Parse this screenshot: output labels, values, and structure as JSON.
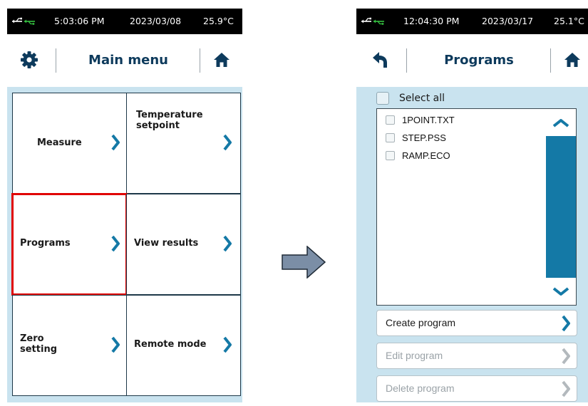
{
  "left_screen": {
    "status": {
      "time": "5:03:06 PM",
      "date": "2023/03/08",
      "temperature": "25.9°C"
    },
    "title": "Main menu",
    "tiles": [
      {
        "label": "Measure",
        "selected": false
      },
      {
        "label": "Temperature setpoint",
        "selected": false
      },
      {
        "label": "Programs",
        "selected": true
      },
      {
        "label": "View results",
        "selected": false
      },
      {
        "label": "Zero setting",
        "selected": false
      },
      {
        "label": "Remote mode",
        "selected": false
      }
    ],
    "icons": {
      "left": "gear-icon",
      "right": "home-icon"
    }
  },
  "right_screen": {
    "status": {
      "time": "12:04:30 PM",
      "date": "2023/03/17",
      "temperature": "25.1°C"
    },
    "title": "Programs",
    "select_all_label": "Select all",
    "files": [
      "1POINT.TXT",
      "STEP.PSS",
      "RAMP.ECO"
    ],
    "actions": [
      {
        "label": "Create program",
        "enabled": true
      },
      {
        "label": "Edit program",
        "enabled": false
      },
      {
        "label": "Delete program",
        "enabled": false
      }
    ],
    "icons": {
      "left": "back-icon",
      "right": "home-icon"
    }
  },
  "colors": {
    "accent": "#1479a6",
    "title_text": "#0d3a5c",
    "panel_background": "#c9e3ef",
    "selection_highlight": "#e00000",
    "usb_green": "#35c240"
  }
}
